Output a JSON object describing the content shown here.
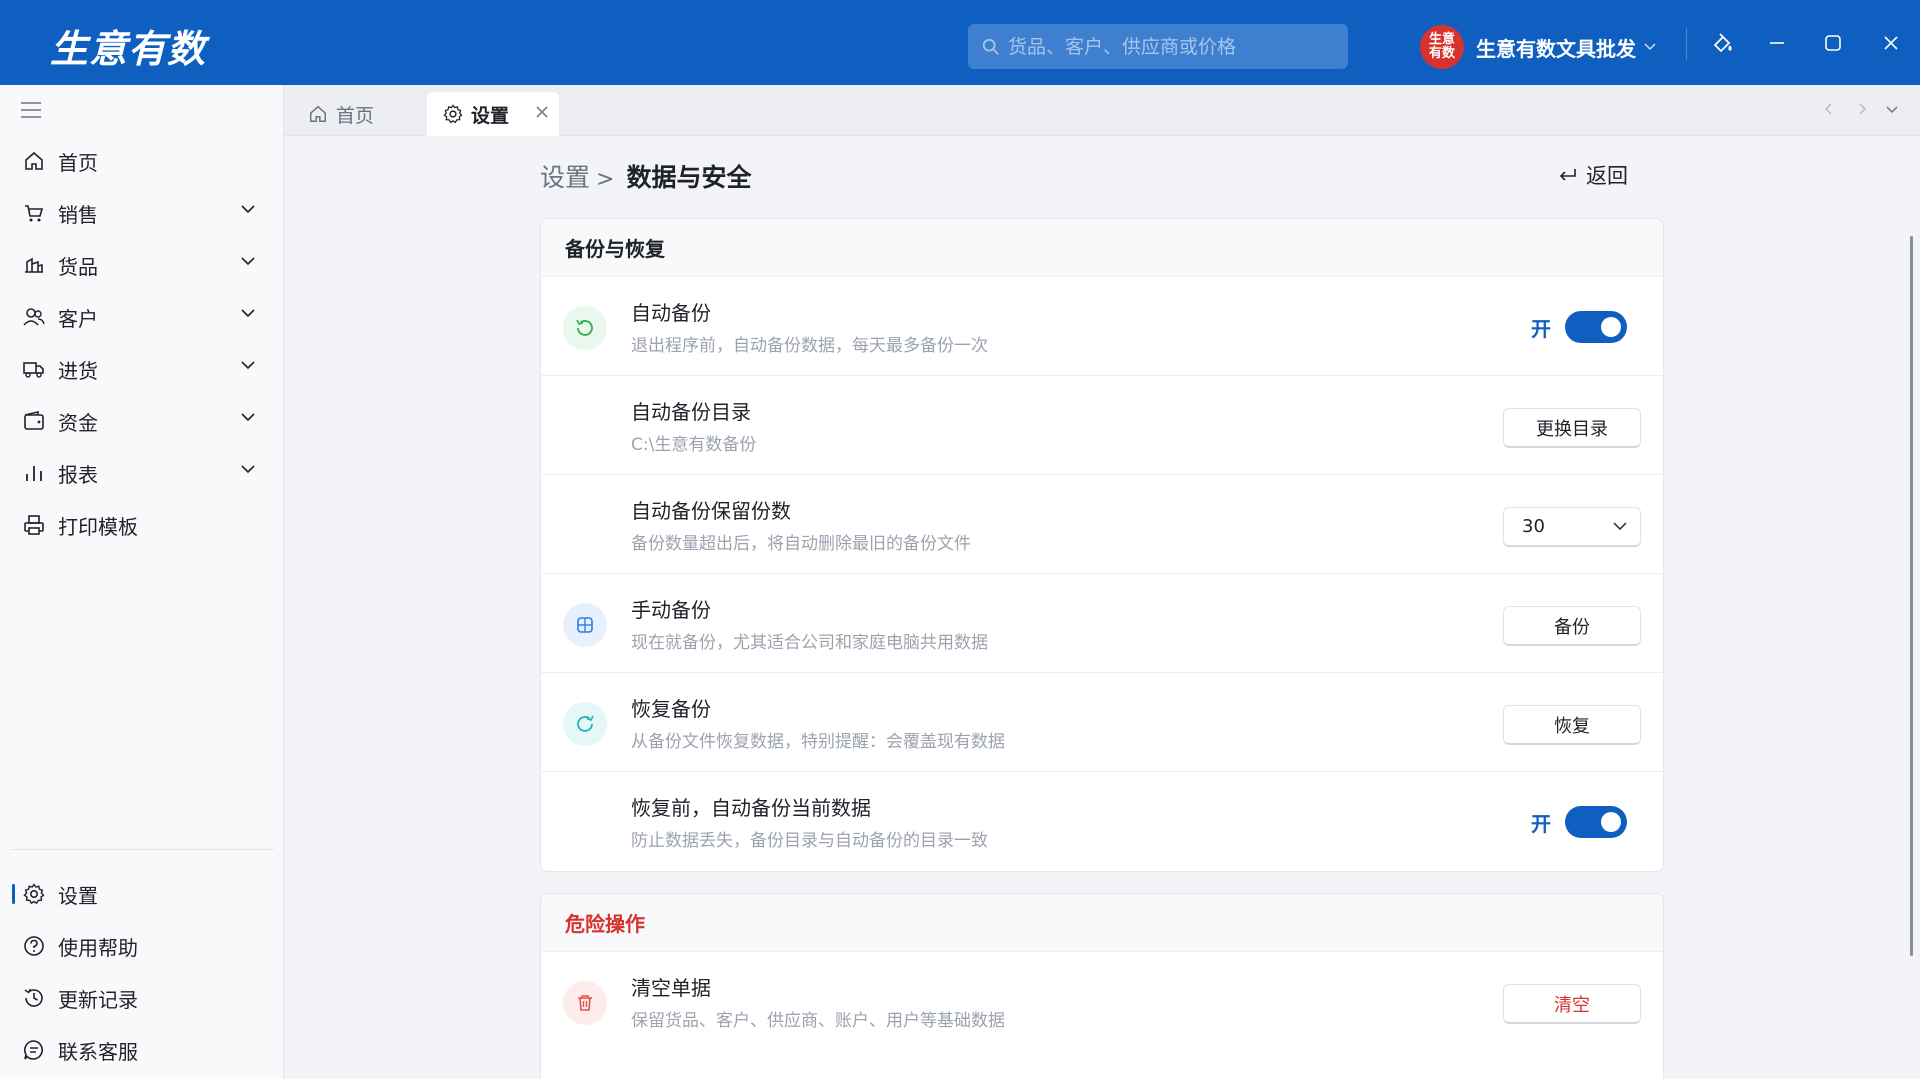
{
  "app": {
    "logo": "生意有数",
    "search_placeholder": "货品、客户、供应商或价格",
    "avatar_text": "生意有数",
    "account_name": "生意有数文具批发"
  },
  "sidebar": {
    "items": [
      {
        "label": "首页",
        "icon": "home-icon",
        "expandable": false
      },
      {
        "label": "销售",
        "icon": "cart-icon",
        "expandable": true
      },
      {
        "label": "货品",
        "icon": "goods-icon",
        "expandable": true
      },
      {
        "label": "客户",
        "icon": "customers-icon",
        "expandable": true
      },
      {
        "label": "进货",
        "icon": "truck-icon",
        "expandable": true
      },
      {
        "label": "资金",
        "icon": "wallet-icon",
        "expandable": true
      },
      {
        "label": "报表",
        "icon": "chart-icon",
        "expandable": true
      },
      {
        "label": "打印模板",
        "icon": "printer-icon",
        "expandable": false
      }
    ],
    "bottom": [
      {
        "label": "设置",
        "icon": "gear-icon",
        "active": true
      },
      {
        "label": "使用帮助",
        "icon": "help-icon",
        "active": false
      },
      {
        "label": "更新记录",
        "icon": "history-icon",
        "active": false
      },
      {
        "label": "联系客服",
        "icon": "chat-icon",
        "active": false
      }
    ]
  },
  "tabs": [
    {
      "label": "首页",
      "icon": "home-icon",
      "active": false
    },
    {
      "label": "设置",
      "icon": "gear-icon",
      "active": true
    }
  ],
  "page": {
    "breadcrumb_parent": "设置",
    "breadcrumb_sep": ">",
    "title": "数据与安全",
    "back_label": "返回"
  },
  "backup": {
    "heading": "备份与恢复",
    "auto_backup": {
      "title": "自动备份",
      "desc": "退出程序前，自动备份数据，每天最多备份一次",
      "state": "开"
    },
    "auto_dir": {
      "title": "自动备份目录",
      "desc": "C:\\生意有数备份",
      "button": "更换目录"
    },
    "keep_count": {
      "title": "自动备份保留份数",
      "desc": "备份数量超出后，将自动删除最旧的备份文件",
      "value": "30"
    },
    "manual": {
      "title": "手动备份",
      "desc": "现在就备份，尤其适合公司和家庭电脑共用数据",
      "button": "备份"
    },
    "restore": {
      "title": "恢复备份",
      "desc": "从备份文件恢复数据，特别提醒：会覆盖现有数据",
      "button": "恢复"
    },
    "pre_restore": {
      "title": "恢复前，自动备份当前数据",
      "desc": "防止数据丢失，备份目录与自动备份的目录一致",
      "state": "开"
    }
  },
  "danger": {
    "heading": "危险操作",
    "clear": {
      "title": "清空单据",
      "desc": "保留货品、客户、供应商、账户、用户等基础数据",
      "button": "清空"
    }
  },
  "colors": {
    "brand": "#0e5fbf",
    "danger": "#d9312b"
  }
}
